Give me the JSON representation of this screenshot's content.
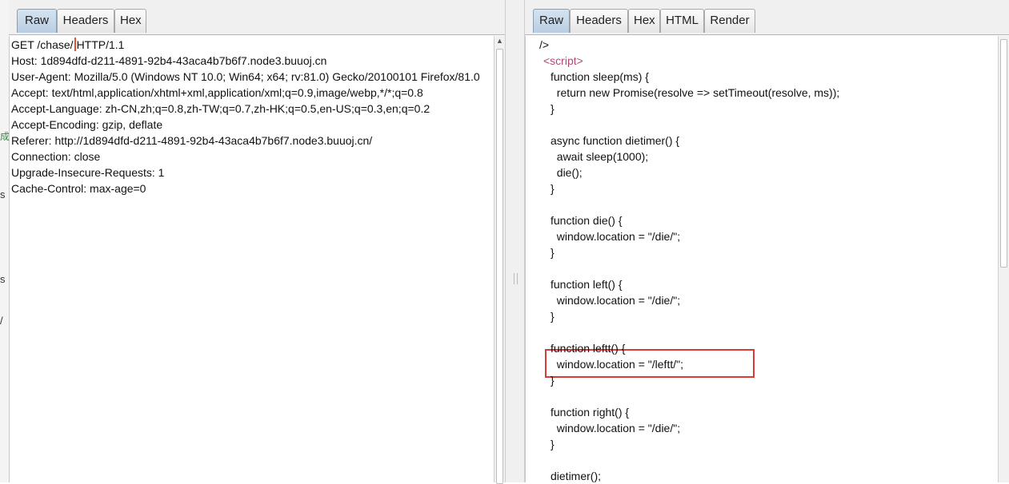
{
  "left_edge": {
    "fragments": [
      "s",
      "成",
      "s",
      "/"
    ]
  },
  "request": {
    "tabs": [
      "Raw",
      "Headers",
      "Hex"
    ],
    "active_tab": "Raw",
    "request_line_before_caret": "GET /chase/",
    "request_line_after_caret": "HTTP/1.1",
    "headers": [
      "Host: 1d894dfd-d211-4891-92b4-43aca4b7b6f7.node3.buuoj.cn",
      "User-Agent: Mozilla/5.0 (Windows NT 10.0; Win64; x64; rv:81.0) Gecko/20100101 Firefox/81.0",
      "Accept: text/html,application/xhtml+xml,application/xml;q=0.9,image/webp,*/*;q=0.8",
      "Accept-Language: zh-CN,zh;q=0.8,zh-TW;q=0.7,zh-HK;q=0.5,en-US;q=0.3,en;q=0.2",
      "Accept-Encoding: gzip, deflate",
      "Referer: http://1d894dfd-d211-4891-92b4-43aca4b7b6f7.node3.buuoj.cn/",
      "Connection: close",
      "Upgrade-Insecure-Requests: 1",
      "Cache-Control: max-age=0"
    ]
  },
  "response": {
    "tabs": [
      "Raw",
      "Headers",
      "Hex",
      "HTML",
      "Render"
    ],
    "active_tab": "Raw",
    "open_tag": "<script>",
    "lines": [
      "/>",
      "",
      "function sleep(ms) {",
      "  return new Promise(resolve => setTimeout(resolve, ms));",
      "}",
      "",
      "async function dietimer() {",
      "  await sleep(1000);",
      "  die();",
      "}",
      "",
      "function die() {",
      "  window.location = \"/die/\";",
      "}",
      "",
      "function left() {",
      "  window.location = \"/die/\";",
      "}",
      "",
      "function leftt() {",
      "  window.location = \"/leftt/\";",
      "}",
      "",
      "function right() {",
      "  window.location = \"/die/\";",
      "}",
      "",
      "dietimer();"
    ],
    "highlight_color": "#d93b3b"
  }
}
